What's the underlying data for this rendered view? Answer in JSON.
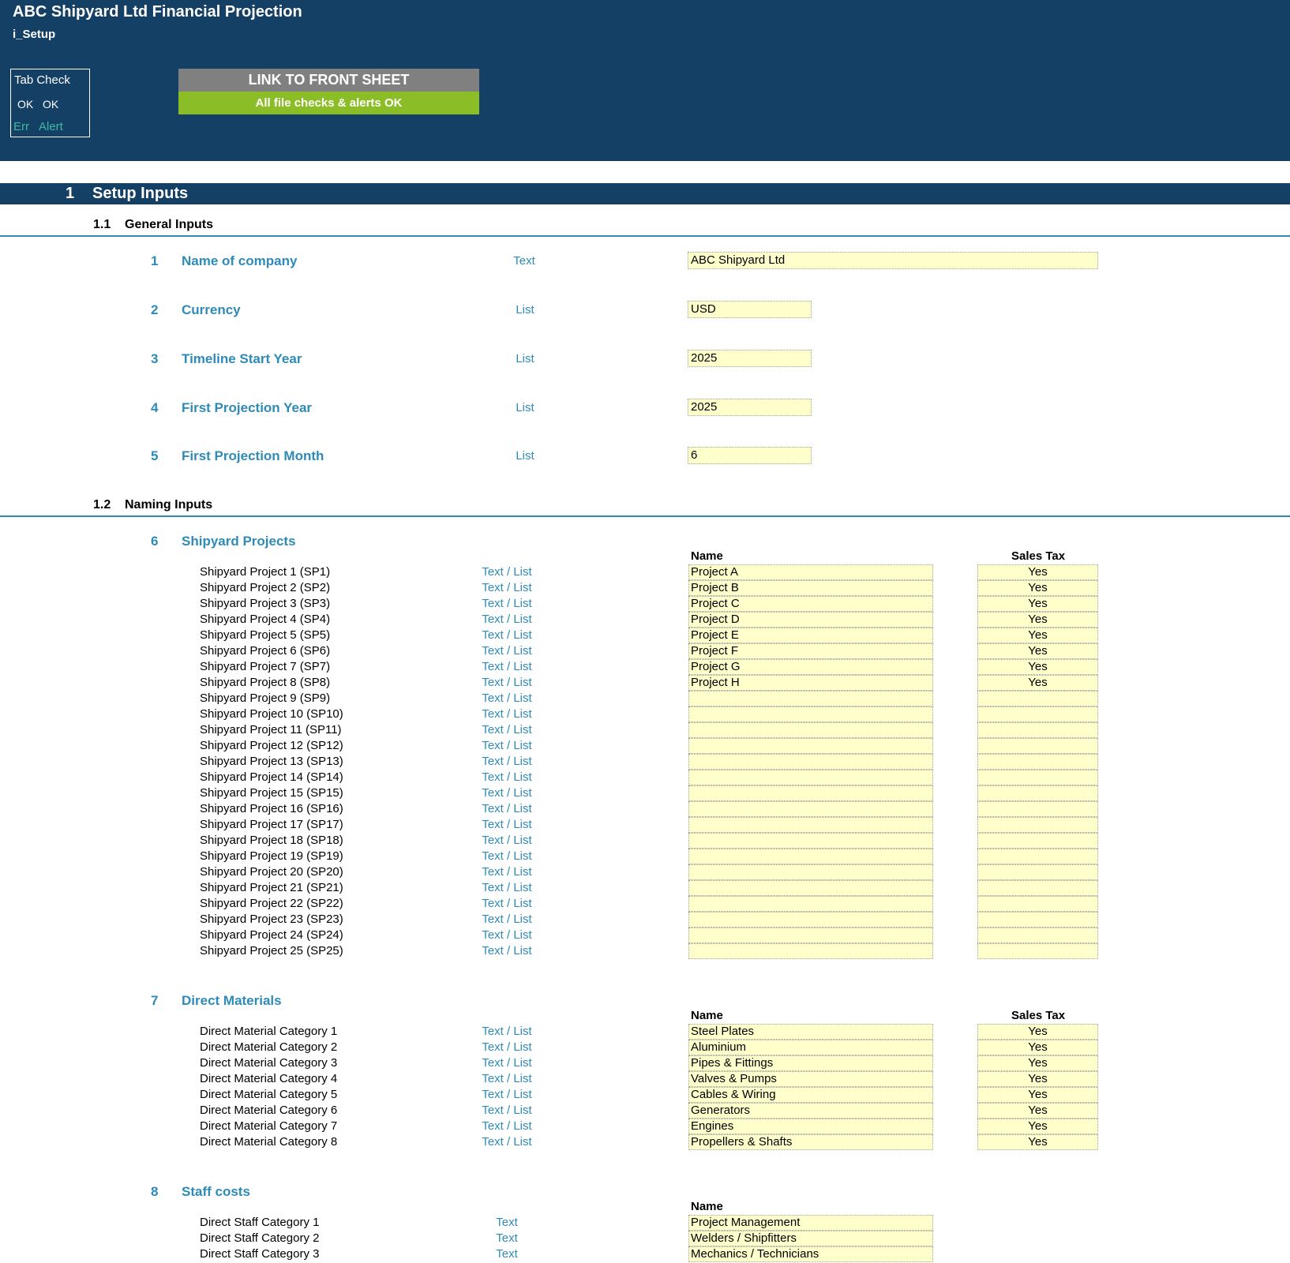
{
  "header": {
    "title": "ABC Shipyard Ltd Financial Projection",
    "sheet": "i_Setup",
    "tab_check": {
      "title": "Tab Check",
      "ok1": "OK",
      "ok2": "OK",
      "err": "Err",
      "alert": "Alert"
    },
    "link_button": "LINK TO FRONT SHEET",
    "status": "All file checks & alerts OK"
  },
  "colors": {
    "header_bg": "#154066",
    "accent": "#2e8bb8",
    "input_bg": "#ffffcc",
    "ok_green": "#8bbd26",
    "alert_teal": "#3eb9a4"
  },
  "section": {
    "num": "1",
    "title": "Setup Inputs"
  },
  "general": {
    "num": "1.1",
    "title": "General Inputs",
    "inputs": [
      {
        "num": "1",
        "label": "Name of company",
        "type": "Text",
        "value": "ABC Shipyard Ltd"
      },
      {
        "num": "2",
        "label": "Currency",
        "type": "List",
        "value": "USD"
      },
      {
        "num": "3",
        "label": "Timeline Start Year",
        "type": "List",
        "value": "2025"
      },
      {
        "num": "4",
        "label": "First Projection Year",
        "type": "List",
        "value": "2025"
      },
      {
        "num": "5",
        "label": "First Projection Month",
        "type": "List",
        "value": "6"
      }
    ]
  },
  "naming": {
    "num": "1.2",
    "title": "Naming Inputs",
    "projects": {
      "num": "6",
      "title": "Shipyard Projects",
      "name_header": "Name",
      "tax_header": "Sales Tax",
      "rows": [
        {
          "label": "Shipyard Project 1 (SP1)",
          "type": "Text / List",
          "name": "Project A",
          "tax": "Yes"
        },
        {
          "label": "Shipyard Project 2 (SP2)",
          "type": "Text / List",
          "name": "Project B",
          "tax": "Yes"
        },
        {
          "label": "Shipyard Project 3 (SP3)",
          "type": "Text / List",
          "name": "Project C",
          "tax": "Yes"
        },
        {
          "label": "Shipyard Project 4 (SP4)",
          "type": "Text / List",
          "name": "Project D",
          "tax": "Yes"
        },
        {
          "label": "Shipyard Project 5 (SP5)",
          "type": "Text / List",
          "name": "Project E",
          "tax": "Yes"
        },
        {
          "label": "Shipyard Project 6 (SP6)",
          "type": "Text / List",
          "name": "Project F",
          "tax": "Yes"
        },
        {
          "label": "Shipyard Project 7 (SP7)",
          "type": "Text / List",
          "name": "Project G",
          "tax": "Yes"
        },
        {
          "label": "Shipyard Project 8 (SP8)",
          "type": "Text / List",
          "name": "Project H",
          "tax": "Yes"
        },
        {
          "label": "Shipyard Project 9 (SP9)",
          "type": "Text / List",
          "name": "",
          "tax": ""
        },
        {
          "label": "Shipyard Project 10 (SP10)",
          "type": "Text / List",
          "name": "",
          "tax": ""
        },
        {
          "label": "Shipyard Project 11 (SP11)",
          "type": "Text / List",
          "name": "",
          "tax": ""
        },
        {
          "label": "Shipyard Project 12 (SP12)",
          "type": "Text / List",
          "name": "",
          "tax": ""
        },
        {
          "label": "Shipyard Project 13 (SP13)",
          "type": "Text / List",
          "name": "",
          "tax": ""
        },
        {
          "label": "Shipyard Project 14 (SP14)",
          "type": "Text / List",
          "name": "",
          "tax": ""
        },
        {
          "label": "Shipyard Project 15 (SP15)",
          "type": "Text / List",
          "name": "",
          "tax": ""
        },
        {
          "label": "Shipyard Project 16 (SP16)",
          "type": "Text / List",
          "name": "",
          "tax": ""
        },
        {
          "label": "Shipyard Project 17 (SP17)",
          "type": "Text / List",
          "name": "",
          "tax": ""
        },
        {
          "label": "Shipyard Project 18 (SP18)",
          "type": "Text / List",
          "name": "",
          "tax": ""
        },
        {
          "label": "Shipyard Project 19 (SP19)",
          "type": "Text / List",
          "name": "",
          "tax": ""
        },
        {
          "label": "Shipyard Project 20 (SP20)",
          "type": "Text / List",
          "name": "",
          "tax": ""
        },
        {
          "label": "Shipyard Project 21 (SP21)",
          "type": "Text / List",
          "name": "",
          "tax": ""
        },
        {
          "label": "Shipyard Project 22 (SP22)",
          "type": "Text / List",
          "name": "",
          "tax": ""
        },
        {
          "label": "Shipyard Project 23 (SP23)",
          "type": "Text / List",
          "name": "",
          "tax": ""
        },
        {
          "label": "Shipyard Project 24 (SP24)",
          "type": "Text / List",
          "name": "",
          "tax": ""
        },
        {
          "label": "Shipyard Project 25 (SP25)",
          "type": "Text / List",
          "name": "",
          "tax": ""
        }
      ]
    },
    "materials": {
      "num": "7",
      "title": "Direct Materials",
      "name_header": "Name",
      "tax_header": "Sales Tax",
      "rows": [
        {
          "label": "Direct Material Category 1",
          "type": "Text / List",
          "name": "Steel Plates",
          "tax": "Yes"
        },
        {
          "label": "Direct Material Category 2",
          "type": "Text / List",
          "name": "Aluminium",
          "tax": "Yes"
        },
        {
          "label": "Direct Material Category 3",
          "type": "Text / List",
          "name": "Pipes & Fittings",
          "tax": "Yes"
        },
        {
          "label": "Direct Material Category 4",
          "type": "Text / List",
          "name": "Valves & Pumps",
          "tax": "Yes"
        },
        {
          "label": "Direct Material Category 5",
          "type": "Text / List",
          "name": "Cables & Wiring",
          "tax": "Yes"
        },
        {
          "label": "Direct Material Category 6",
          "type": "Text / List",
          "name": "Generators",
          "tax": "Yes"
        },
        {
          "label": "Direct Material Category 7",
          "type": "Text / List",
          "name": "Engines",
          "tax": "Yes"
        },
        {
          "label": "Direct Material Category 8",
          "type": "Text / List",
          "name": "Propellers & Shafts",
          "tax": "Yes"
        }
      ]
    },
    "staff": {
      "num": "8",
      "title": "Staff costs",
      "name_header": "Name",
      "rows": [
        {
          "label": "Direct Staff Category 1",
          "type": "Text",
          "name": "Project Management"
        },
        {
          "label": "Direct Staff Category 2",
          "type": "Text",
          "name": "Welders / Shipfitters"
        },
        {
          "label": "Direct Staff Category 3",
          "type": "Text",
          "name": "Mechanics / Technicians"
        }
      ]
    }
  }
}
